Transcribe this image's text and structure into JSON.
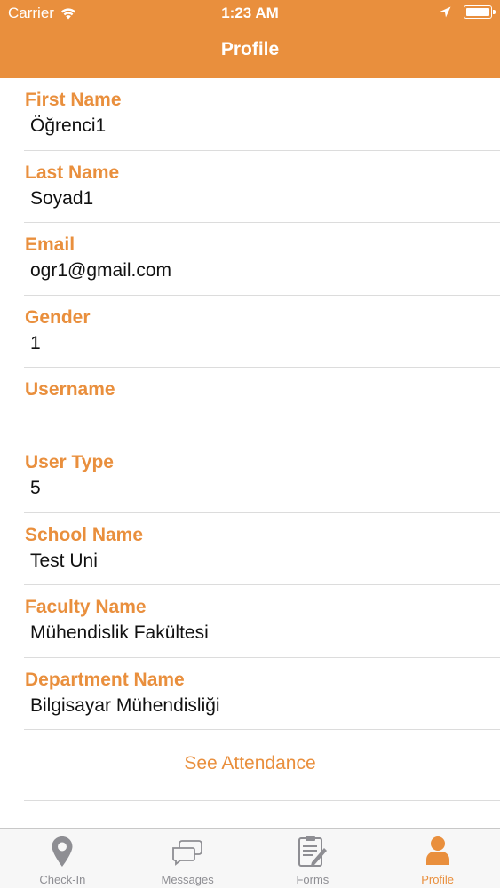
{
  "status_bar": {
    "carrier": "Carrier",
    "time": "1:23 AM"
  },
  "nav": {
    "title": "Profile"
  },
  "fields": [
    {
      "label": "First Name",
      "value": "Öğrenci1"
    },
    {
      "label": "Last Name",
      "value": "Soyad1"
    },
    {
      "label": "Email",
      "value": "ogr1@gmail.com"
    },
    {
      "label": "Gender",
      "value": "1"
    },
    {
      "label": "Username",
      "value": ""
    },
    {
      "label": "User Type",
      "value": "5"
    },
    {
      "label": "School Name",
      "value": "Test Uni"
    },
    {
      "label": "Faculty Name",
      "value": "Mühendislik Fakültesi"
    },
    {
      "label": "Department Name",
      "value": "Bilgisayar Mühendisliği"
    }
  ],
  "attendance_button": "See Attendance",
  "tabs": [
    {
      "label": "Check-In",
      "icon": "location-pin-icon",
      "active": false
    },
    {
      "label": "Messages",
      "icon": "chat-bubbles-icon",
      "active": false
    },
    {
      "label": "Forms",
      "icon": "form-document-icon",
      "active": false
    },
    {
      "label": "Profile",
      "icon": "person-icon",
      "active": true
    }
  ],
  "colors": {
    "accent": "#E98F3D",
    "inactive_tab": "#8e8e93"
  }
}
